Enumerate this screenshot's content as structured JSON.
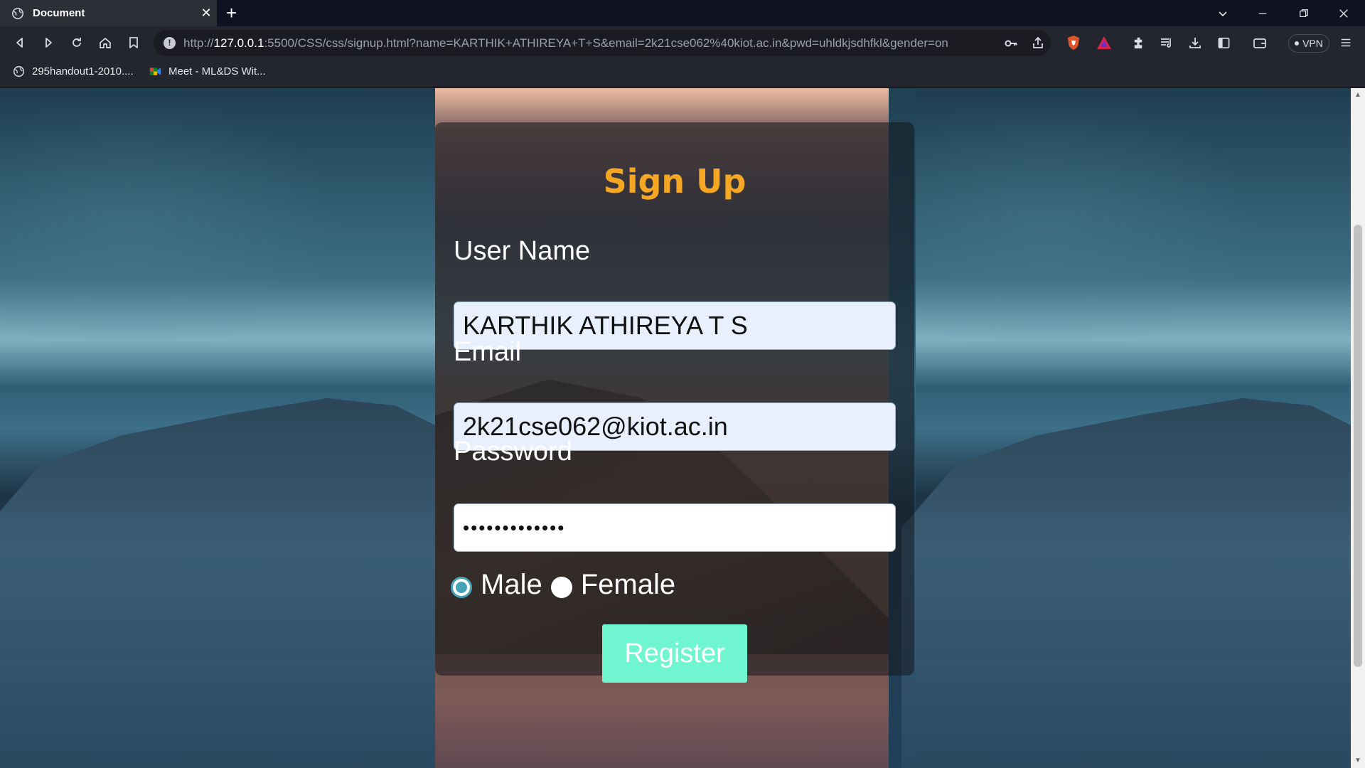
{
  "browser": {
    "tab_title": "Document",
    "new_tab_symbol": "+",
    "tab_close_symbol": "✕",
    "url_host": "127.0.0.1",
    "url_prefix": "http://",
    "url_rest": ":5500/CSS/css/signup.html?name=KARTHIK+ATHIREYA+T+S&email=2k21cse062%40kiot.ac.in&pwd=uhldkjsdhfkl&gender=on",
    "vpn_label": "VPN",
    "bookmarks": [
      {
        "label": "295handout1-2010...."
      },
      {
        "label": "Meet - ML&DS Wit..."
      }
    ]
  },
  "form": {
    "title": "Sign Up",
    "username_label": "User Name",
    "username_value": "KARTHIK ATHIREYA T S",
    "email_label": "Email",
    "email_value": "2k21cse062@kiot.ac.in",
    "password_label": "Password",
    "password_masked": "•••••••••••••",
    "gender_options": [
      {
        "label": "Male",
        "selected": true
      },
      {
        "label": "Female",
        "selected": false
      }
    ],
    "register_label": "Register"
  },
  "colors": {
    "title": "#f5a623",
    "register_bg": "#6ff5cf",
    "radio_accent": "#45a3b8"
  }
}
